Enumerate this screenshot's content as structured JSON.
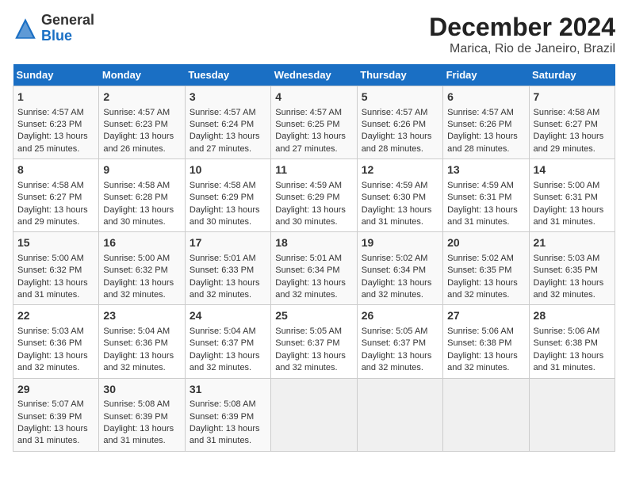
{
  "header": {
    "logo_general": "General",
    "logo_blue": "Blue",
    "title": "December 2024",
    "subtitle": "Marica, Rio de Janeiro, Brazil"
  },
  "days_of_week": [
    "Sunday",
    "Monday",
    "Tuesday",
    "Wednesday",
    "Thursday",
    "Friday",
    "Saturday"
  ],
  "weeks": [
    [
      {
        "day": 1,
        "lines": [
          "Sunrise: 4:57 AM",
          "Sunset: 6:23 PM",
          "Daylight: 13 hours",
          "and 25 minutes."
        ]
      },
      {
        "day": 2,
        "lines": [
          "Sunrise: 4:57 AM",
          "Sunset: 6:23 PM",
          "Daylight: 13 hours",
          "and 26 minutes."
        ]
      },
      {
        "day": 3,
        "lines": [
          "Sunrise: 4:57 AM",
          "Sunset: 6:24 PM",
          "Daylight: 13 hours",
          "and 27 minutes."
        ]
      },
      {
        "day": 4,
        "lines": [
          "Sunrise: 4:57 AM",
          "Sunset: 6:25 PM",
          "Daylight: 13 hours",
          "and 27 minutes."
        ]
      },
      {
        "day": 5,
        "lines": [
          "Sunrise: 4:57 AM",
          "Sunset: 6:26 PM",
          "Daylight: 13 hours",
          "and 28 minutes."
        ]
      },
      {
        "day": 6,
        "lines": [
          "Sunrise: 4:57 AM",
          "Sunset: 6:26 PM",
          "Daylight: 13 hours",
          "and 28 minutes."
        ]
      },
      {
        "day": 7,
        "lines": [
          "Sunrise: 4:58 AM",
          "Sunset: 6:27 PM",
          "Daylight: 13 hours",
          "and 29 minutes."
        ]
      }
    ],
    [
      {
        "day": 8,
        "lines": [
          "Sunrise: 4:58 AM",
          "Sunset: 6:27 PM",
          "Daylight: 13 hours",
          "and 29 minutes."
        ]
      },
      {
        "day": 9,
        "lines": [
          "Sunrise: 4:58 AM",
          "Sunset: 6:28 PM",
          "Daylight: 13 hours",
          "and 30 minutes."
        ]
      },
      {
        "day": 10,
        "lines": [
          "Sunrise: 4:58 AM",
          "Sunset: 6:29 PM",
          "Daylight: 13 hours",
          "and 30 minutes."
        ]
      },
      {
        "day": 11,
        "lines": [
          "Sunrise: 4:59 AM",
          "Sunset: 6:29 PM",
          "Daylight: 13 hours",
          "and 30 minutes."
        ]
      },
      {
        "day": 12,
        "lines": [
          "Sunrise: 4:59 AM",
          "Sunset: 6:30 PM",
          "Daylight: 13 hours",
          "and 31 minutes."
        ]
      },
      {
        "day": 13,
        "lines": [
          "Sunrise: 4:59 AM",
          "Sunset: 6:31 PM",
          "Daylight: 13 hours",
          "and 31 minutes."
        ]
      },
      {
        "day": 14,
        "lines": [
          "Sunrise: 5:00 AM",
          "Sunset: 6:31 PM",
          "Daylight: 13 hours",
          "and 31 minutes."
        ]
      }
    ],
    [
      {
        "day": 15,
        "lines": [
          "Sunrise: 5:00 AM",
          "Sunset: 6:32 PM",
          "Daylight: 13 hours",
          "and 31 minutes."
        ]
      },
      {
        "day": 16,
        "lines": [
          "Sunrise: 5:00 AM",
          "Sunset: 6:32 PM",
          "Daylight: 13 hours",
          "and 32 minutes."
        ]
      },
      {
        "day": 17,
        "lines": [
          "Sunrise: 5:01 AM",
          "Sunset: 6:33 PM",
          "Daylight: 13 hours",
          "and 32 minutes."
        ]
      },
      {
        "day": 18,
        "lines": [
          "Sunrise: 5:01 AM",
          "Sunset: 6:34 PM",
          "Daylight: 13 hours",
          "and 32 minutes."
        ]
      },
      {
        "day": 19,
        "lines": [
          "Sunrise: 5:02 AM",
          "Sunset: 6:34 PM",
          "Daylight: 13 hours",
          "and 32 minutes."
        ]
      },
      {
        "day": 20,
        "lines": [
          "Sunrise: 5:02 AM",
          "Sunset: 6:35 PM",
          "Daylight: 13 hours",
          "and 32 minutes."
        ]
      },
      {
        "day": 21,
        "lines": [
          "Sunrise: 5:03 AM",
          "Sunset: 6:35 PM",
          "Daylight: 13 hours",
          "and 32 minutes."
        ]
      }
    ],
    [
      {
        "day": 22,
        "lines": [
          "Sunrise: 5:03 AM",
          "Sunset: 6:36 PM",
          "Daylight: 13 hours",
          "and 32 minutes."
        ]
      },
      {
        "day": 23,
        "lines": [
          "Sunrise: 5:04 AM",
          "Sunset: 6:36 PM",
          "Daylight: 13 hours",
          "and 32 minutes."
        ]
      },
      {
        "day": 24,
        "lines": [
          "Sunrise: 5:04 AM",
          "Sunset: 6:37 PM",
          "Daylight: 13 hours",
          "and 32 minutes."
        ]
      },
      {
        "day": 25,
        "lines": [
          "Sunrise: 5:05 AM",
          "Sunset: 6:37 PM",
          "Daylight: 13 hours",
          "and 32 minutes."
        ]
      },
      {
        "day": 26,
        "lines": [
          "Sunrise: 5:05 AM",
          "Sunset: 6:37 PM",
          "Daylight: 13 hours",
          "and 32 minutes."
        ]
      },
      {
        "day": 27,
        "lines": [
          "Sunrise: 5:06 AM",
          "Sunset: 6:38 PM",
          "Daylight: 13 hours",
          "and 32 minutes."
        ]
      },
      {
        "day": 28,
        "lines": [
          "Sunrise: 5:06 AM",
          "Sunset: 6:38 PM",
          "Daylight: 13 hours",
          "and 31 minutes."
        ]
      }
    ],
    [
      {
        "day": 29,
        "lines": [
          "Sunrise: 5:07 AM",
          "Sunset: 6:39 PM",
          "Daylight: 13 hours",
          "and 31 minutes."
        ]
      },
      {
        "day": 30,
        "lines": [
          "Sunrise: 5:08 AM",
          "Sunset: 6:39 PM",
          "Daylight: 13 hours",
          "and 31 minutes."
        ]
      },
      {
        "day": 31,
        "lines": [
          "Sunrise: 5:08 AM",
          "Sunset: 6:39 PM",
          "Daylight: 13 hours",
          "and 31 minutes."
        ]
      },
      null,
      null,
      null,
      null
    ]
  ]
}
